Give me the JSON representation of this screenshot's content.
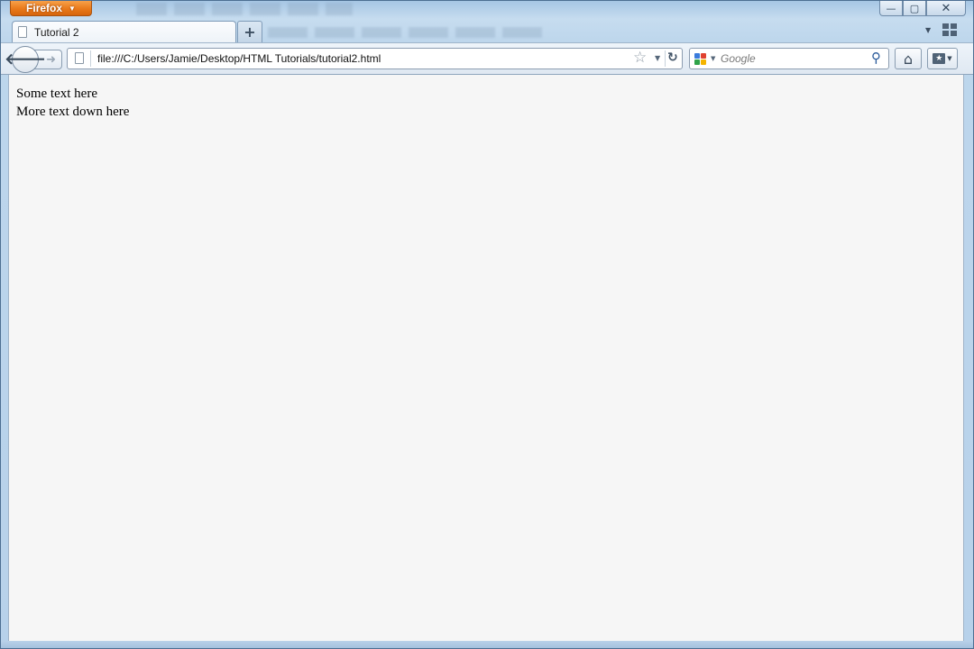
{
  "window": {
    "app_button_label": "Firefox",
    "controls": {
      "minimize": "—",
      "maximize": "▢",
      "close": "✕"
    }
  },
  "tabs": [
    {
      "title": "Tutorial 2",
      "active": true
    }
  ],
  "toolbar": {
    "new_tab_label": "+",
    "url": "file:///C:/Users/Jamie/Desktop/HTML Tutorials/tutorial2.html",
    "search_placeholder": "Google"
  },
  "icons": {
    "back": "back-arrow-icon",
    "forward": "forward-arrow-icon",
    "page": "page-icon",
    "star": "bookmark-star-icon",
    "reload": "reload-icon",
    "search_engine": "google-icon",
    "magnifier": "magnifier-icon",
    "home": "home-icon",
    "bookmarks": "bookmarks-menu-icon",
    "tab_groups": "tab-groups-icon"
  },
  "colors": {
    "firefox_button": "#e9791a",
    "frame": "#bdd6ec",
    "content_background": "#f6f6f6",
    "google_blue": "#3a7bdc",
    "google_red": "#e0412f",
    "google_yellow": "#f4b400",
    "google_green": "#2fa34a"
  },
  "content": {
    "lines": [
      "Some text here",
      "More text down here"
    ]
  }
}
